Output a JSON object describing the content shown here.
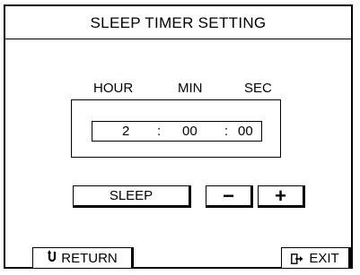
{
  "title": "SLEEP TIMER SETTING",
  "columns": {
    "hour": "HOUR",
    "min": "MIN",
    "sec": "SEC"
  },
  "time": {
    "hour": "2",
    "min": "00",
    "sec": "00",
    "separator": ":"
  },
  "buttons": {
    "sleep": "SLEEP",
    "minus": "−",
    "plus": "+",
    "return": "RETURN",
    "exit": "EXIT"
  },
  "icons": {
    "return": "u-turn-arrow-icon",
    "exit": "exit-arrow-icon"
  }
}
